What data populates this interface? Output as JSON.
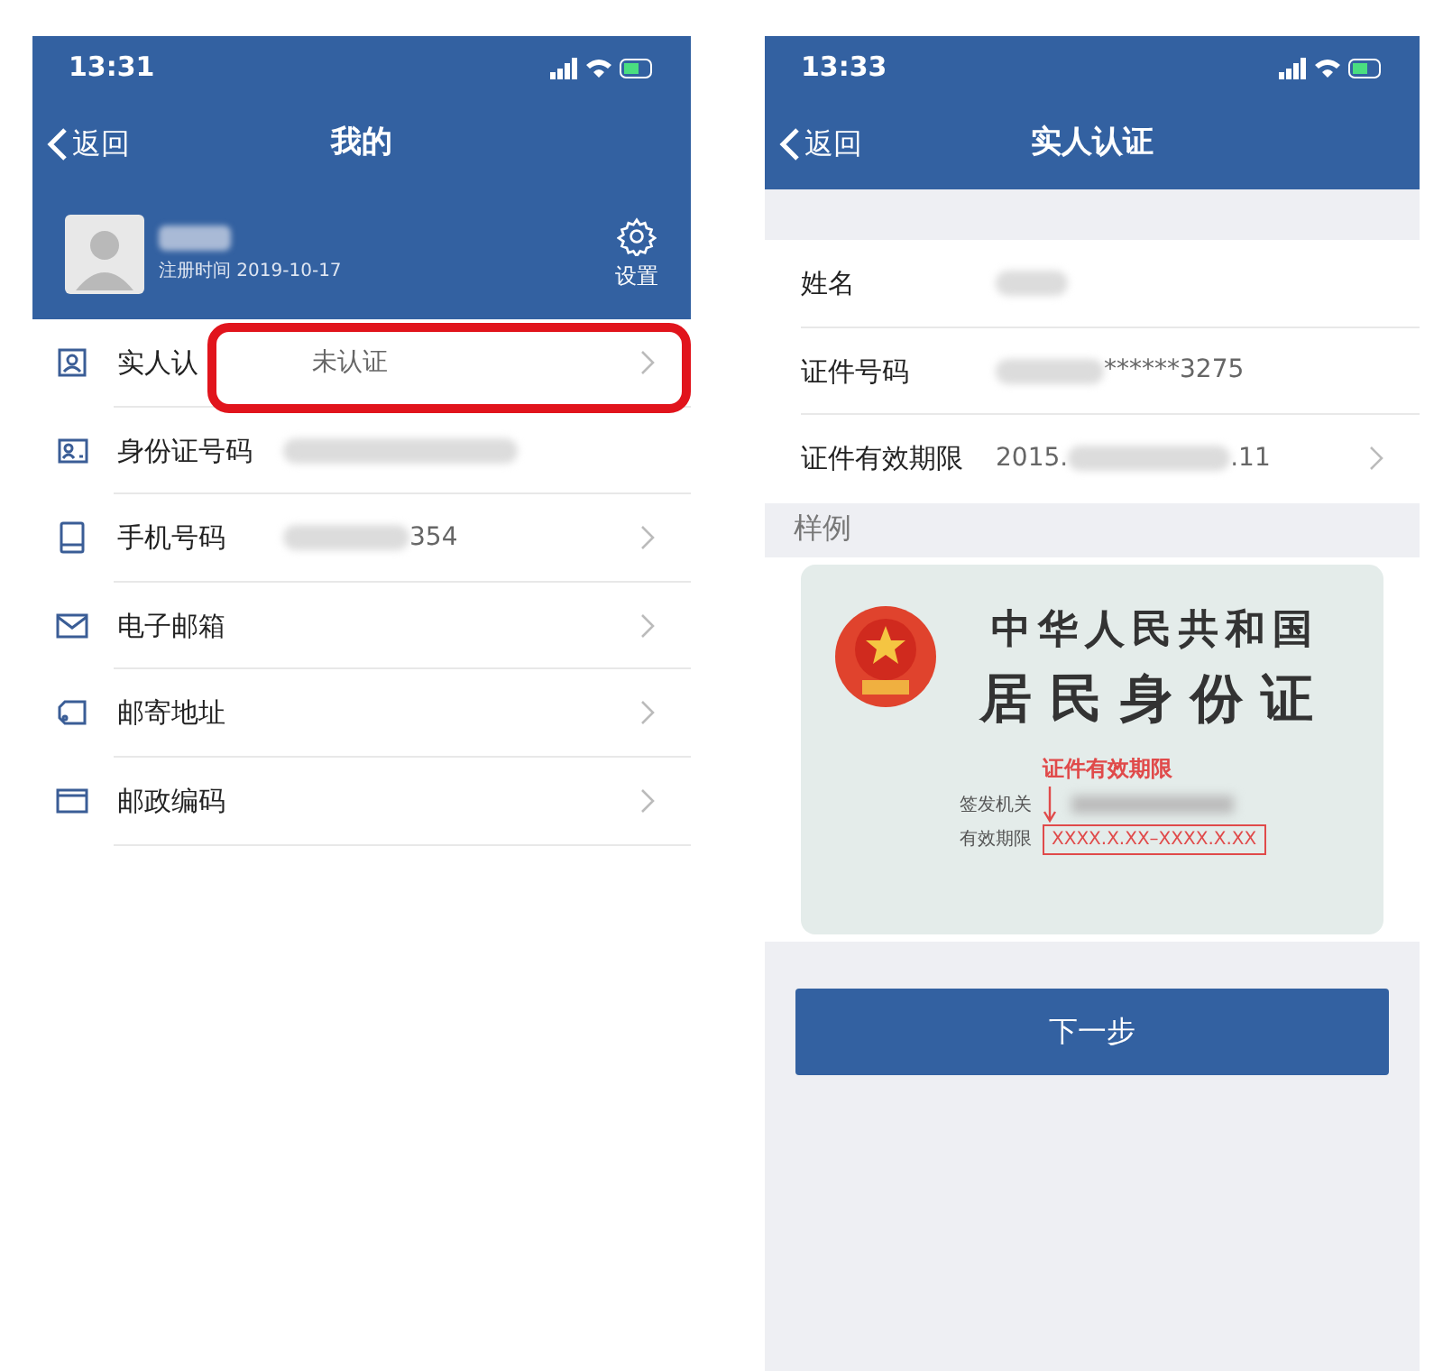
{
  "left_screen": {
    "status_bar": {
      "time": "13:31"
    },
    "nav": {
      "back": "返回",
      "title": "我的"
    },
    "profile": {
      "name_blurred": true,
      "registered": "注册时间 2019-10-17",
      "settings": "设置"
    },
    "menu": [
      {
        "kind": "person-card",
        "label": "实人认",
        "value": "未认证",
        "blurred": false,
        "chevron": true,
        "highlighted": true
      },
      {
        "kind": "id-card",
        "label": "身份证号码",
        "blurred": true,
        "chevron": false,
        "highlighted": false
      },
      {
        "kind": "phone",
        "label": "手机号码",
        "value": "354",
        "blurred": true,
        "chevron": true,
        "highlighted": false
      },
      {
        "kind": "mail",
        "label": "电子邮箱",
        "blurred": false,
        "chevron": true,
        "highlighted": false
      },
      {
        "kind": "tag",
        "label": "邮寄地址",
        "blurred": false,
        "chevron": true,
        "highlighted": false
      },
      {
        "kind": "box",
        "label": "邮政编码",
        "blurred": false,
        "chevron": true,
        "highlighted": false
      }
    ]
  },
  "right_screen": {
    "status_bar": {
      "time": "13:33"
    },
    "nav": {
      "back": "返回",
      "title": "实人认证"
    },
    "form": [
      {
        "label": "姓名",
        "blurred": true,
        "chevron": false
      },
      {
        "label": "证件号码",
        "blurred": true,
        "value": "******3275",
        "chevron": false
      },
      {
        "label": "证件有效期限",
        "value_before": "2015.",
        "blurred": true,
        "value": ".11",
        "chevron": true
      }
    ],
    "sample_label": "样例",
    "sample_card": {
      "title": "中华人民共和国",
      "subtitle": "居民身份证",
      "callout": "证件有效期限",
      "issuer_label": "签发机关",
      "validity_label": "有效期限",
      "validity": "XXXX.X.XX–XXXX.X.XX"
    },
    "next_button": "下一步"
  }
}
